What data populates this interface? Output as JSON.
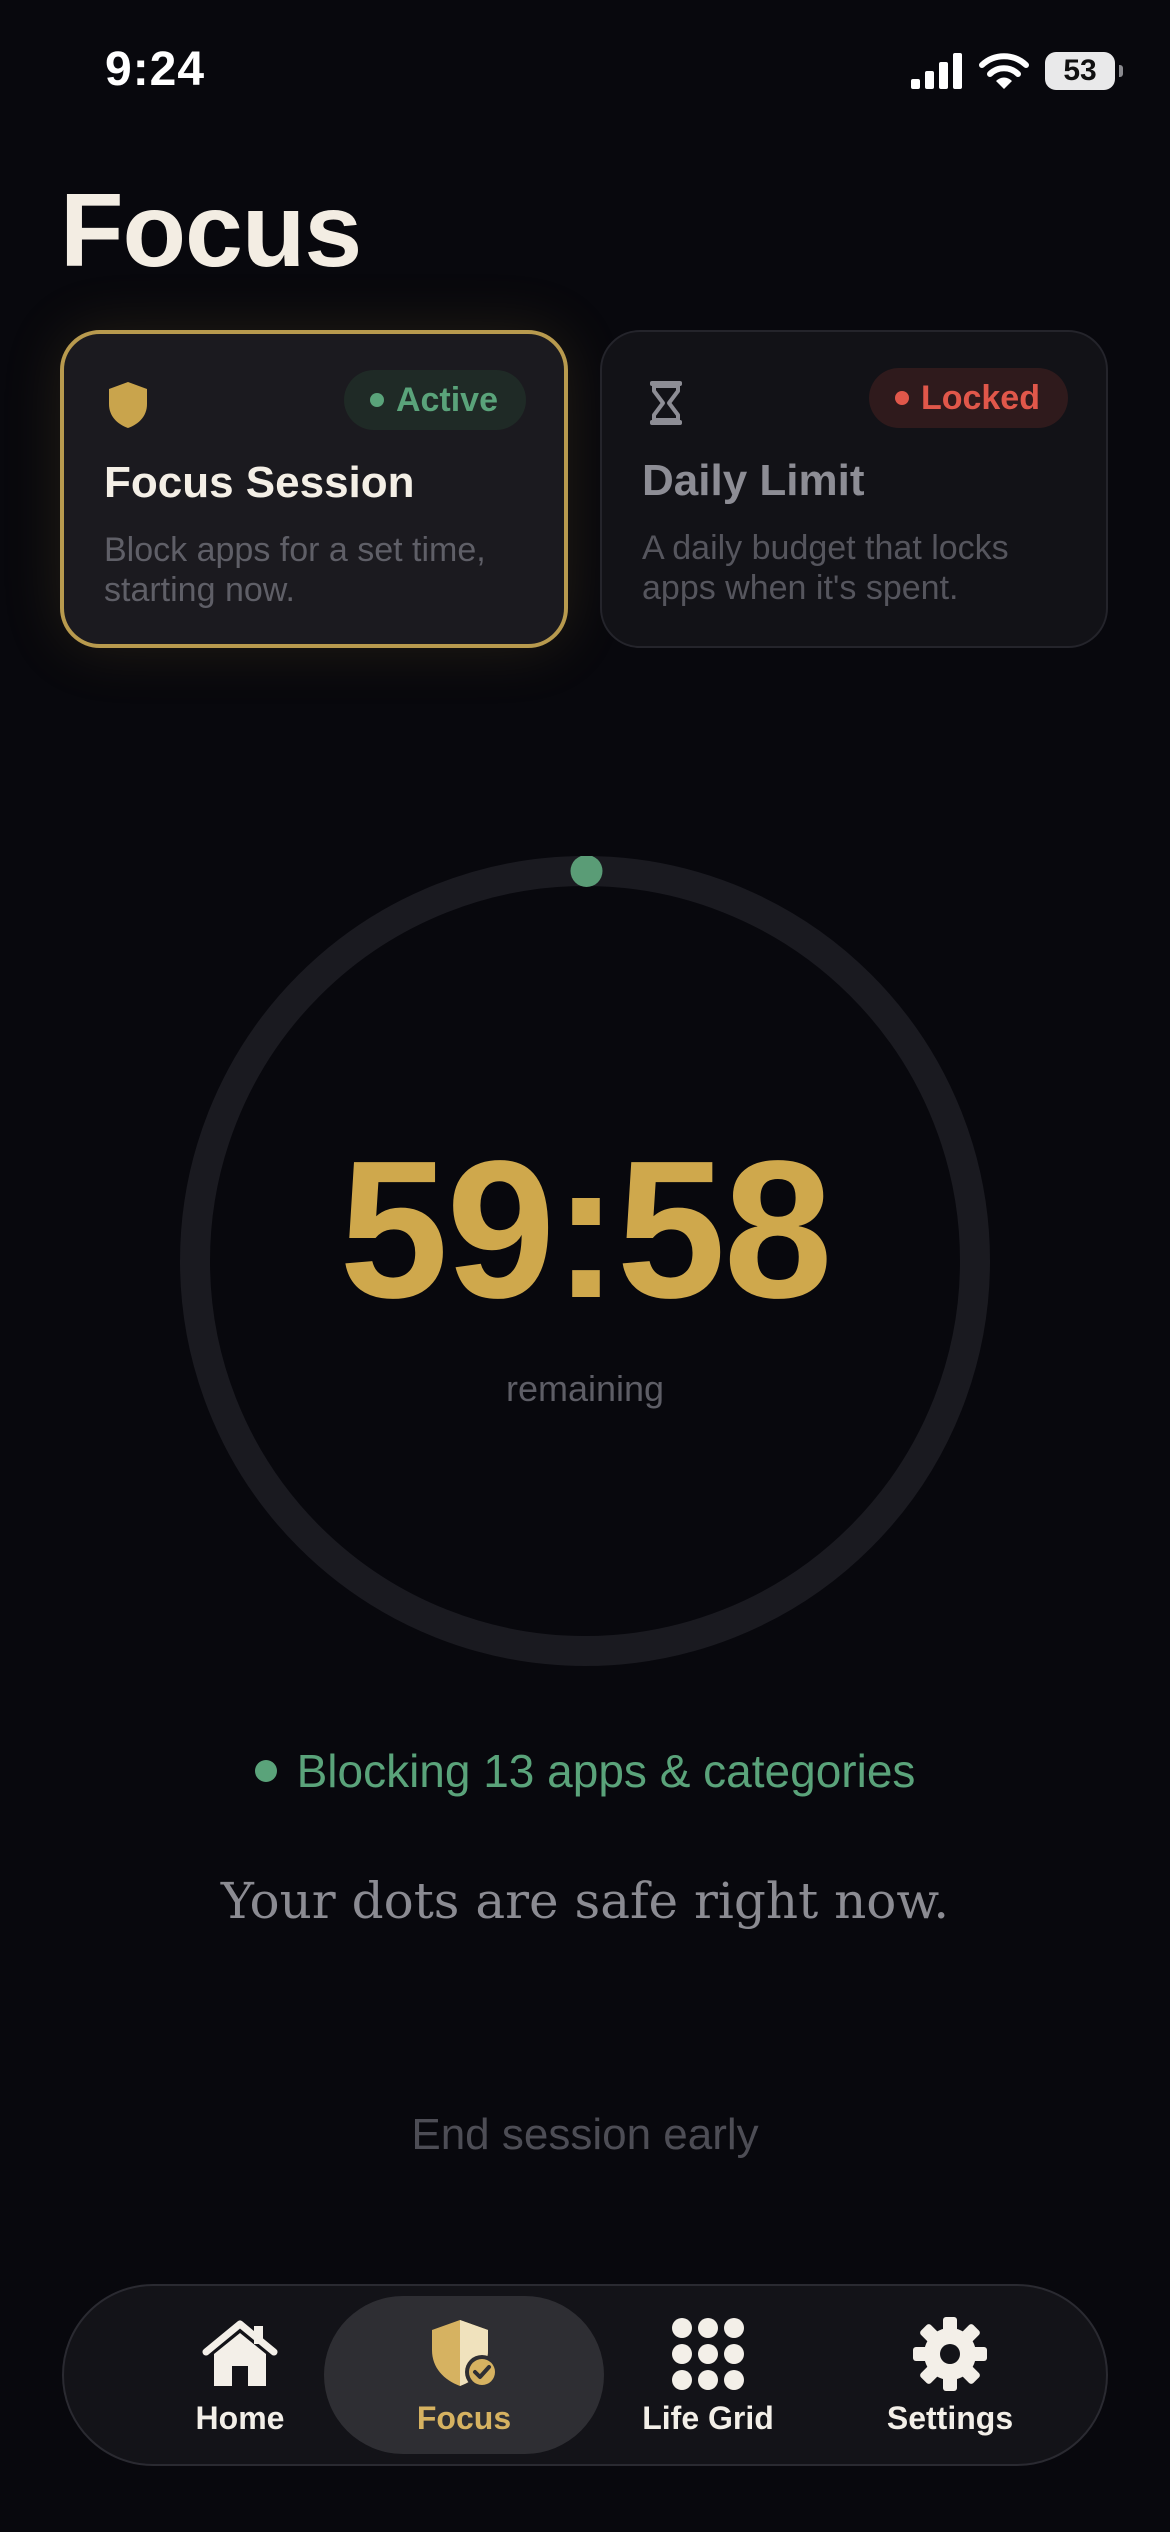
{
  "status_bar": {
    "time": "9:24",
    "battery": "53",
    "icons": [
      "cellular-signal-icon",
      "wifi-icon",
      "battery-icon"
    ]
  },
  "page": {
    "title": "Focus"
  },
  "modes": [
    {
      "title": "Focus Session",
      "description": "Block apps for a set time, starting now.",
      "badge": "Active",
      "icon": "shield-icon",
      "selected": true
    },
    {
      "title": "Daily Limit",
      "description": "A daily budget that locks apps when it's spent.",
      "badge": "Locked",
      "icon": "hourglass-icon",
      "selected": false
    }
  ],
  "timer": {
    "value": "59:58",
    "label": "remaining",
    "progress_fraction": 0.0006
  },
  "blocking": {
    "text": "Blocking 13 apps & categories"
  },
  "message": {
    "text": "Your dots are safe right now."
  },
  "actions": {
    "end_early": "End session early"
  },
  "tabs": [
    {
      "label": "Home",
      "icon": "home-icon",
      "selected": false
    },
    {
      "label": "Focus",
      "icon": "shield-check-icon",
      "selected": true
    },
    {
      "label": "Life Grid",
      "icon": "grid-dots-icon",
      "selected": false
    },
    {
      "label": "Settings",
      "icon": "gear-icon",
      "selected": false
    }
  ],
  "colors": {
    "background": "#08080d",
    "accent_gold": "#cfa84c",
    "active_green": "#5aa37a",
    "locked_red": "#e0574a"
  }
}
